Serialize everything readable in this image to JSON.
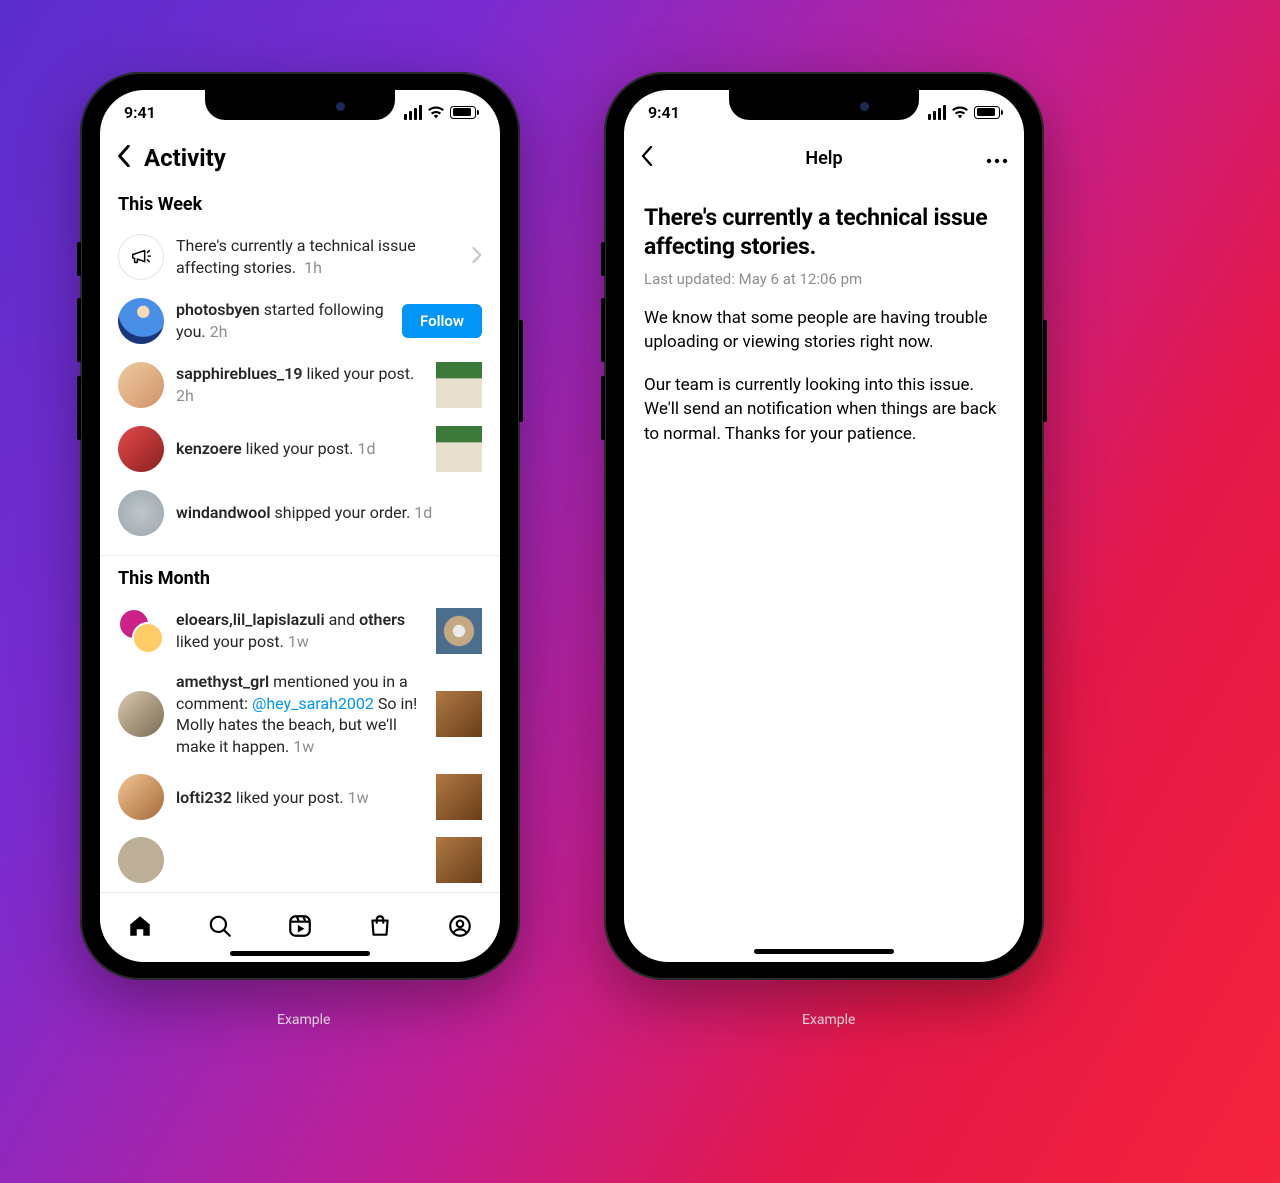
{
  "captions": {
    "left": "Example",
    "right": "Example"
  },
  "status": {
    "time": "9:41"
  },
  "left_screen": {
    "title": "Activity",
    "sections": {
      "week": {
        "header": "This Week",
        "banner": {
          "text": "There's currently a technical issue affecting stories.",
          "time": "1h"
        },
        "items": [
          {
            "user": "photosbyen",
            "action": " started following you.",
            "time": "2h",
            "follow_label": "Follow"
          },
          {
            "user": "sapphireblues_19",
            "action": " liked your post.",
            "time": "2h"
          },
          {
            "user": "kenzoere",
            "action": " liked your post.",
            "time": "1d"
          },
          {
            "user": "windandwool",
            "action": " shipped your order.",
            "time": "1d"
          }
        ]
      },
      "month": {
        "header": "This Month",
        "items": [
          {
            "user": "eloears,lil_lapislazuli",
            "joiner": " and ",
            "others": "others",
            "action": " liked your post.",
            "time": "1w"
          },
          {
            "user": "amethyst_grl",
            "action": " mentioned you in a comment: ",
            "mention": "@hey_sarah2002",
            "trailing": " So in! Molly hates the beach, but we'll make it happen.",
            "time": "1w"
          },
          {
            "user": "lofti232",
            "action": " liked your post.",
            "time": "1w"
          }
        ]
      }
    }
  },
  "right_screen": {
    "title": "Help",
    "heading": "There's currently a technical issue affecting stories.",
    "updated": "Last updated: May 6 at 12:06 pm",
    "para1": "We know that some people are having trouble uploading or viewing stories right now.",
    "para2": "Our team is currently looking into this issue. We'll send an notification when things are back to normal. Thanks for your patience."
  }
}
